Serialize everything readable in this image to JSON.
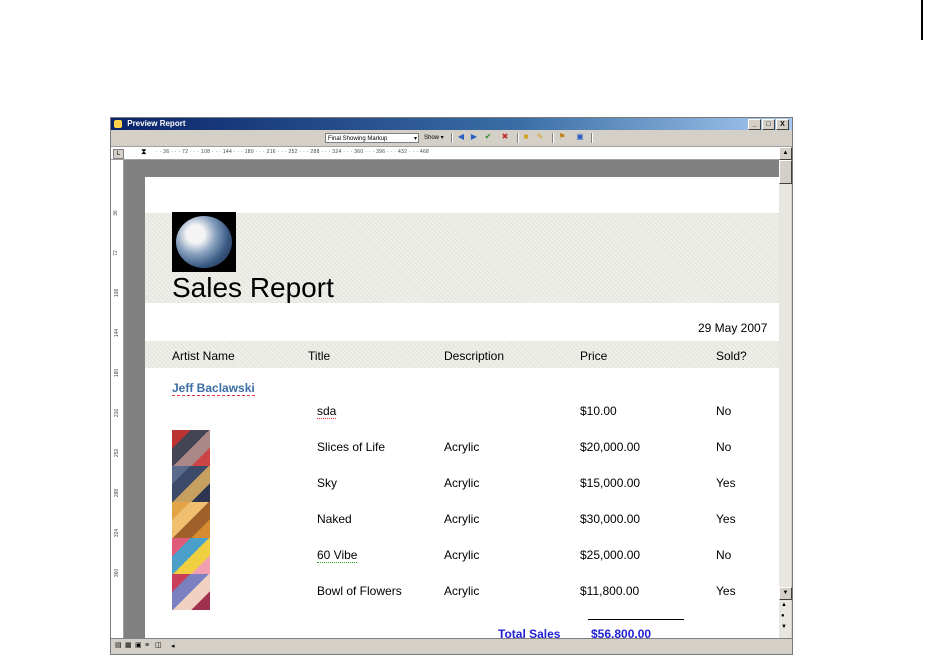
{
  "window": {
    "title": "Preview Report",
    "buttons": [
      "_",
      "□",
      "X"
    ]
  },
  "toolbar": {
    "markup_mode": "Final Showing Markup",
    "show_label": "Show ▾",
    "icons": [
      "previous-change-icon",
      "next-change-icon",
      "accept-change-icon",
      "reject-change-icon",
      "highlight-icon",
      "comment-icon",
      "track-changes-icon",
      "reviewing-pane-icon"
    ]
  },
  "ruler": {
    "marks": "· · 36 · · · 72 · · · 108 · · · 144 · · · 180 · · · 216 · · · 252 · · · 288 · · · 324 · · · 360 · · · 396 · · · 432 · · · 468",
    "vertical_marks": [
      "36",
      "72",
      "108",
      "144",
      "180",
      "216",
      "252",
      "288",
      "324",
      "360"
    ]
  },
  "report": {
    "title": "Sales Report",
    "date": "29 May 2007",
    "columns": [
      "Artist Name",
      "Title",
      "Description",
      "Price",
      "Sold?"
    ],
    "artist": "Jeff Baclawski",
    "rows": [
      {
        "title": "sda",
        "description": "",
        "price": "$10.00",
        "sold": "No",
        "has_thumb": false
      },
      {
        "title": "Slices of Life",
        "description": "Acrylic",
        "price": "$20,000.00",
        "sold": "No",
        "has_thumb": true,
        "thumb_colors": [
          "#b33",
          "#445",
          "#a88",
          "#c44"
        ]
      },
      {
        "title": "Sky",
        "description": "Acrylic",
        "price": "$15,000.00",
        "sold": "Yes",
        "has_thumb": true,
        "thumb_colors": [
          "#5a6a8a",
          "#3c4a6a",
          "#c7a060",
          "#2d3550"
        ]
      },
      {
        "title": "Naked",
        "description": "Acrylic",
        "price": "$30,000.00",
        "sold": "Yes",
        "has_thumb": true,
        "thumb_colors": [
          "#e3a347",
          "#f0c070",
          "#a0602a",
          "#d88a30"
        ]
      },
      {
        "title": "60 Vibe",
        "description": "Acrylic",
        "price": "$25,000.00",
        "sold": "No",
        "has_thumb": true,
        "thumb_colors": [
          "#e05a7a",
          "#4aa0c8",
          "#f0d040",
          "#f2a0b0"
        ]
      },
      {
        "title": "Bowl of Flowers",
        "description": "Acrylic",
        "price": "$11,800.00",
        "sold": "Yes",
        "has_thumb": true,
        "thumb_colors": [
          "#c8405a",
          "#7a80c0",
          "#f0d0c0",
          "#a03050"
        ]
      }
    ],
    "total_label": "Total Sales",
    "total_value": "$56,800.00"
  }
}
